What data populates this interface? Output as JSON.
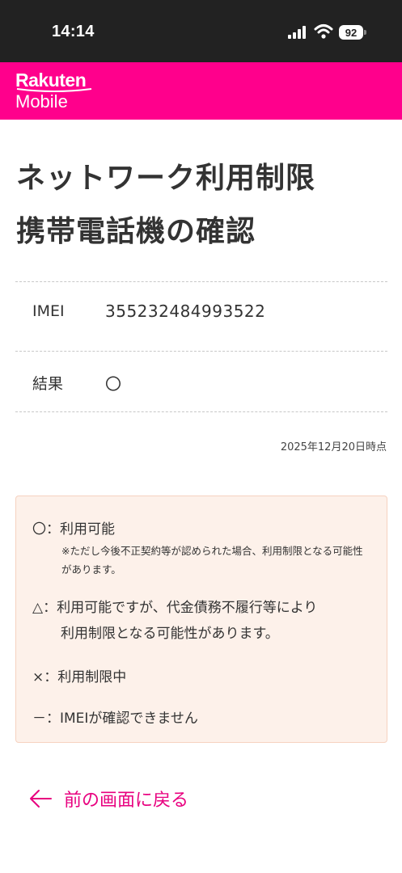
{
  "status_bar": {
    "time": "14:14",
    "battery": "92",
    "icons": [
      "signal-icon",
      "wifi-icon",
      "battery-icon"
    ]
  },
  "brand": {
    "line1": "Rakuten",
    "line2": "Mobile",
    "color": "#ff008c"
  },
  "page": {
    "title_line1": "ネットワーク利用制限",
    "title_line2": "携帯電話機の確認"
  },
  "result_table": {
    "imei_label": "IMEI",
    "imei_value": "355232484993522",
    "result_label": "結果",
    "result_value": "〇"
  },
  "timestamp": "2025年12月20日時点",
  "legend": {
    "available_symbol": "〇",
    "available_text": "：利用可能",
    "available_note": "※ただし今後不正契約等が認められた場合、利用制限となる可能性があります。",
    "triangle_symbol": "△",
    "triangle_text_line1": "：利用可能ですが、代金債務不履行等により",
    "triangle_text_line2": "利用制限となる可能性があります。",
    "restricted_symbol": "×",
    "restricted_text": "：利用制限中",
    "unknown_symbol": "－",
    "unknown_text": "：IMEIが確認できません"
  },
  "back_link": {
    "label": "前の画面に戻る",
    "icon": "arrow-left-icon",
    "color": "#e8007f"
  }
}
